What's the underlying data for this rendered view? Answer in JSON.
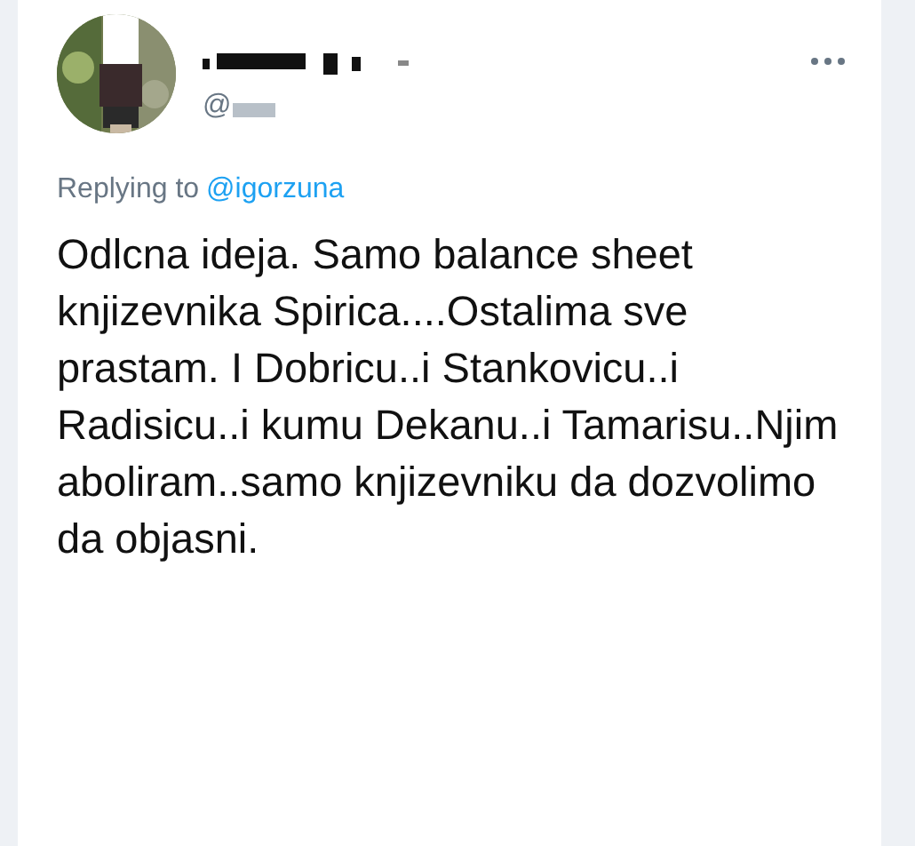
{
  "tweet": {
    "handle": "@",
    "reply_label": "Replying to",
    "reply_to": "@igorzuna",
    "text": "Odlcna ideja. Samo balance sheet knjizevnika Spirica....Ostalima sve prastam. I Dobricu..i Stankovicu..i Radisicu..i kumu Dekanu..i Tamarisu..Njim aboliram..samo knjizevniku da dozvolimo da objasni."
  }
}
